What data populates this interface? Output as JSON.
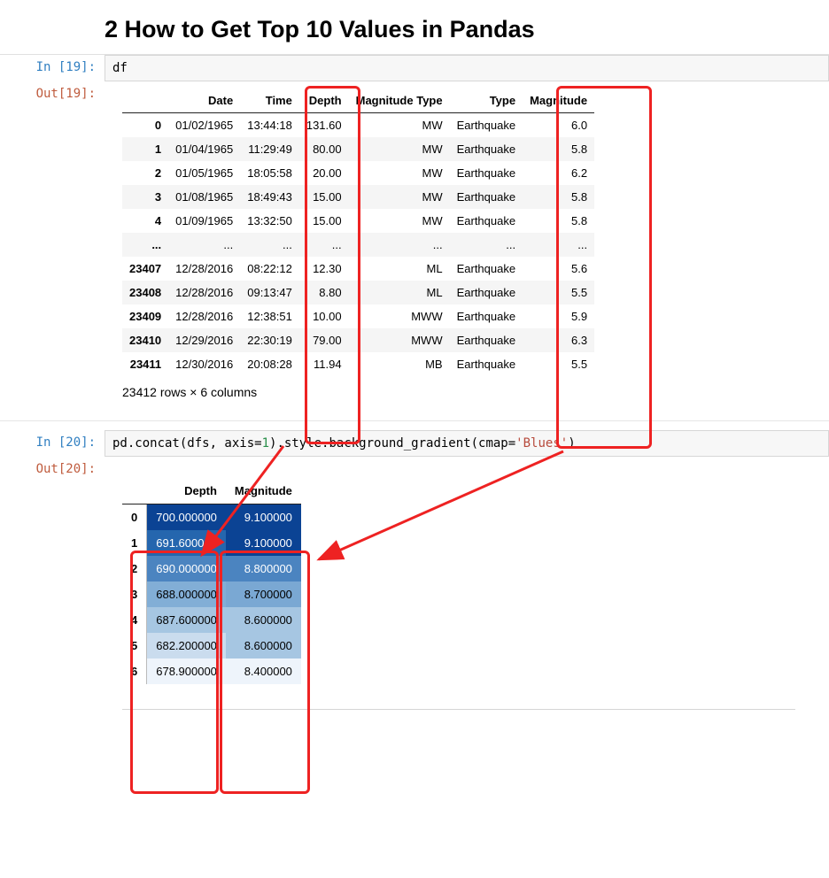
{
  "heading": "2  How to Get Top 10 Values in Pandas",
  "cell1": {
    "in_prompt": "In [19]:",
    "out_prompt": "Out[19]:",
    "code": "df",
    "columns": [
      "Date",
      "Time",
      "Depth",
      "Magnitude Type",
      "Type",
      "Magnitude"
    ],
    "rows": [
      {
        "idx": "0",
        "vals": [
          "01/02/1965",
          "13:44:18",
          "131.60",
          "MW",
          "Earthquake",
          "6.0"
        ]
      },
      {
        "idx": "1",
        "vals": [
          "01/04/1965",
          "11:29:49",
          "80.00",
          "MW",
          "Earthquake",
          "5.8"
        ]
      },
      {
        "idx": "2",
        "vals": [
          "01/05/1965",
          "18:05:58",
          "20.00",
          "MW",
          "Earthquake",
          "6.2"
        ]
      },
      {
        "idx": "3",
        "vals": [
          "01/08/1965",
          "18:49:43",
          "15.00",
          "MW",
          "Earthquake",
          "5.8"
        ]
      },
      {
        "idx": "4",
        "vals": [
          "01/09/1965",
          "13:32:50",
          "15.00",
          "MW",
          "Earthquake",
          "5.8"
        ]
      },
      {
        "idx": "...",
        "vals": [
          "...",
          "...",
          "...",
          "...",
          "...",
          "..."
        ]
      },
      {
        "idx": "23407",
        "vals": [
          "12/28/2016",
          "08:22:12",
          "12.30",
          "ML",
          "Earthquake",
          "5.6"
        ]
      },
      {
        "idx": "23408",
        "vals": [
          "12/28/2016",
          "09:13:47",
          "8.80",
          "ML",
          "Earthquake",
          "5.5"
        ]
      },
      {
        "idx": "23409",
        "vals": [
          "12/28/2016",
          "12:38:51",
          "10.00",
          "MWW",
          "Earthquake",
          "5.9"
        ]
      },
      {
        "idx": "23410",
        "vals": [
          "12/29/2016",
          "22:30:19",
          "79.00",
          "MWW",
          "Earthquake",
          "6.3"
        ]
      },
      {
        "idx": "23411",
        "vals": [
          "12/30/2016",
          "20:08:28",
          "11.94",
          "MB",
          "Earthquake",
          "5.5"
        ]
      }
    ],
    "footer": "23412 rows × 6 columns"
  },
  "cell2": {
    "in_prompt": "In [20]:",
    "out_prompt": "Out[20]:",
    "code_parts": {
      "a": "pd.concat(dfs, axis=",
      "num": "1",
      "b": ").style.background_gradient(cmap=",
      "str": "'Blues'",
      "c": ")"
    },
    "columns": [
      "Depth",
      "Magnitude"
    ],
    "rows": [
      {
        "idx": "0",
        "depth": "700.000000",
        "mag": "9.100000"
      },
      {
        "idx": "1",
        "depth": "691.600000",
        "mag": "9.100000"
      },
      {
        "idx": "2",
        "depth": "690.000000",
        "mag": "8.800000"
      },
      {
        "idx": "3",
        "depth": "688.000000",
        "mag": "8.700000"
      },
      {
        "idx": "4",
        "depth": "687.600000",
        "mag": "8.600000"
      },
      {
        "idx": "5",
        "depth": "682.200000",
        "mag": "8.600000"
      },
      {
        "idx": "6",
        "depth": "678.900000",
        "mag": "8.400000"
      }
    ]
  }
}
